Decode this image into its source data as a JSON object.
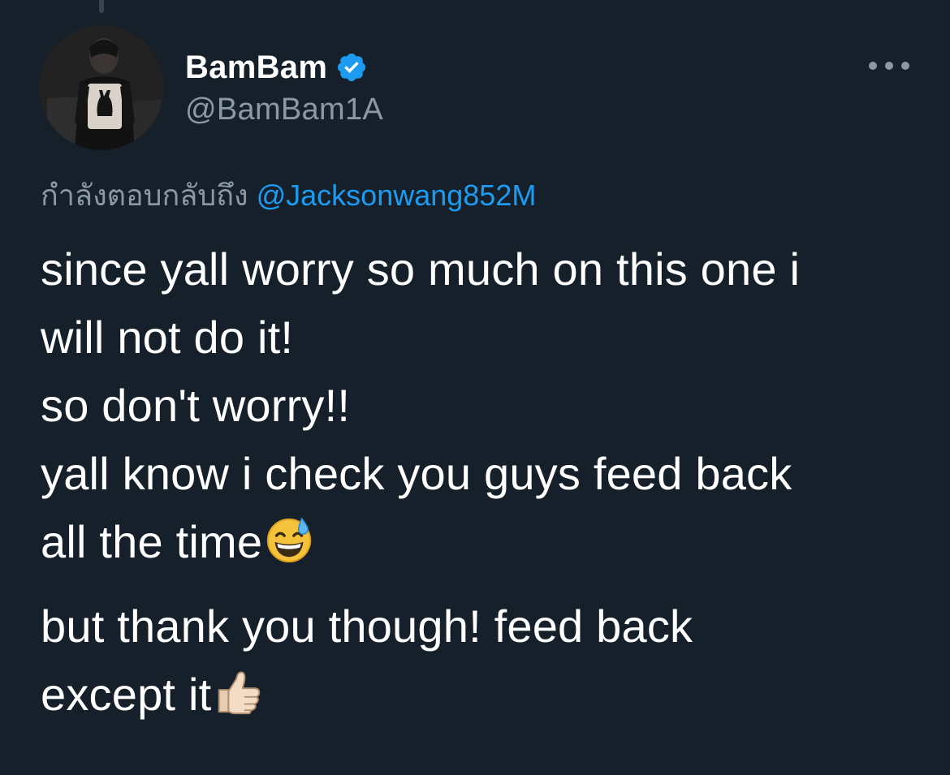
{
  "tweet": {
    "author": {
      "display_name": "BamBam",
      "handle": "@BamBam1A",
      "verified": true,
      "verified_icon": "verified-badge-icon",
      "avatar_icon": "profile-photo"
    },
    "more_icon": "more-options-icon",
    "reply_context": {
      "prefix": "กำลังตอบกลับถึง",
      "mention": "@Jacksonwang852M"
    },
    "text": {
      "paragraph1": [
        "since yall worry so much on this one i",
        "will not do it!",
        "so don't worry!!",
        "yall know i check you guys feed back",
        "all the time"
      ],
      "paragraph1_end_emoji": "grinning-face-with-sweat-emoji",
      "paragraph2": [
        "but thank you though! feed back",
        "except it"
      ],
      "paragraph2_end_emoji": "thumbs-up-emoji"
    }
  },
  "colors": {
    "background": "#15202b",
    "primary_text": "#ffffff",
    "secondary_text": "#8b98a5",
    "accent": "#1d9bf0"
  }
}
